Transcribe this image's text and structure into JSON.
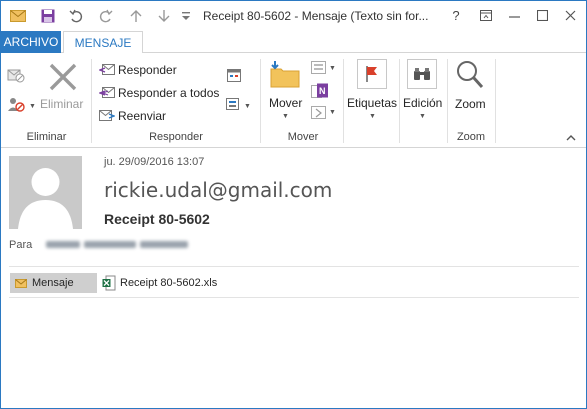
{
  "window": {
    "title": "Receipt 80-5602 - Mensaje (Texto sin for..."
  },
  "title_bar": {
    "help": "?",
    "icons": [
      "mail-icon",
      "save-icon",
      "undo-icon",
      "redo-icon",
      "up-arrow-icon",
      "down-arrow-icon"
    ]
  },
  "tabs": {
    "archivo": "ARCHIVO",
    "mensaje": "MENSAJE"
  },
  "ribbon": {
    "eliminar": {
      "button_label": "Eliminar",
      "group_label": "Eliminar"
    },
    "responder": {
      "responder_label": "Responder",
      "responder_todos_label": "Responder a todos",
      "reenviar_label": "Reenviar",
      "group_label": "Responder"
    },
    "mover": {
      "button_label": "Mover",
      "group_label": "Mover"
    },
    "etiquetas": {
      "button_label": "Etiquetas"
    },
    "edicion": {
      "button_label": "Edición"
    },
    "zoom": {
      "button_label": "Zoom",
      "group_label": "Zoom"
    }
  },
  "message": {
    "date": "ju. 29/09/2016 13:07",
    "sender": "rickie.udal@gmail.com",
    "subject": "Receipt 80-5602",
    "to_label": "Para",
    "to_value": "(blurred recipient)"
  },
  "attachments": {
    "message_tab": "Mensaje",
    "file_name": "Receipt 80-5602.xls"
  },
  "colors": {
    "accent": "#2b79c2",
    "archivo_tab_bg": "#2b79c2",
    "attachment_tab_bg": "#cfcfcf",
    "excel_green": "#1e7145",
    "flag_red": "#d9402b",
    "onenote_purple": "#7b3fa0",
    "folder_yellow": "#f2c35b"
  }
}
